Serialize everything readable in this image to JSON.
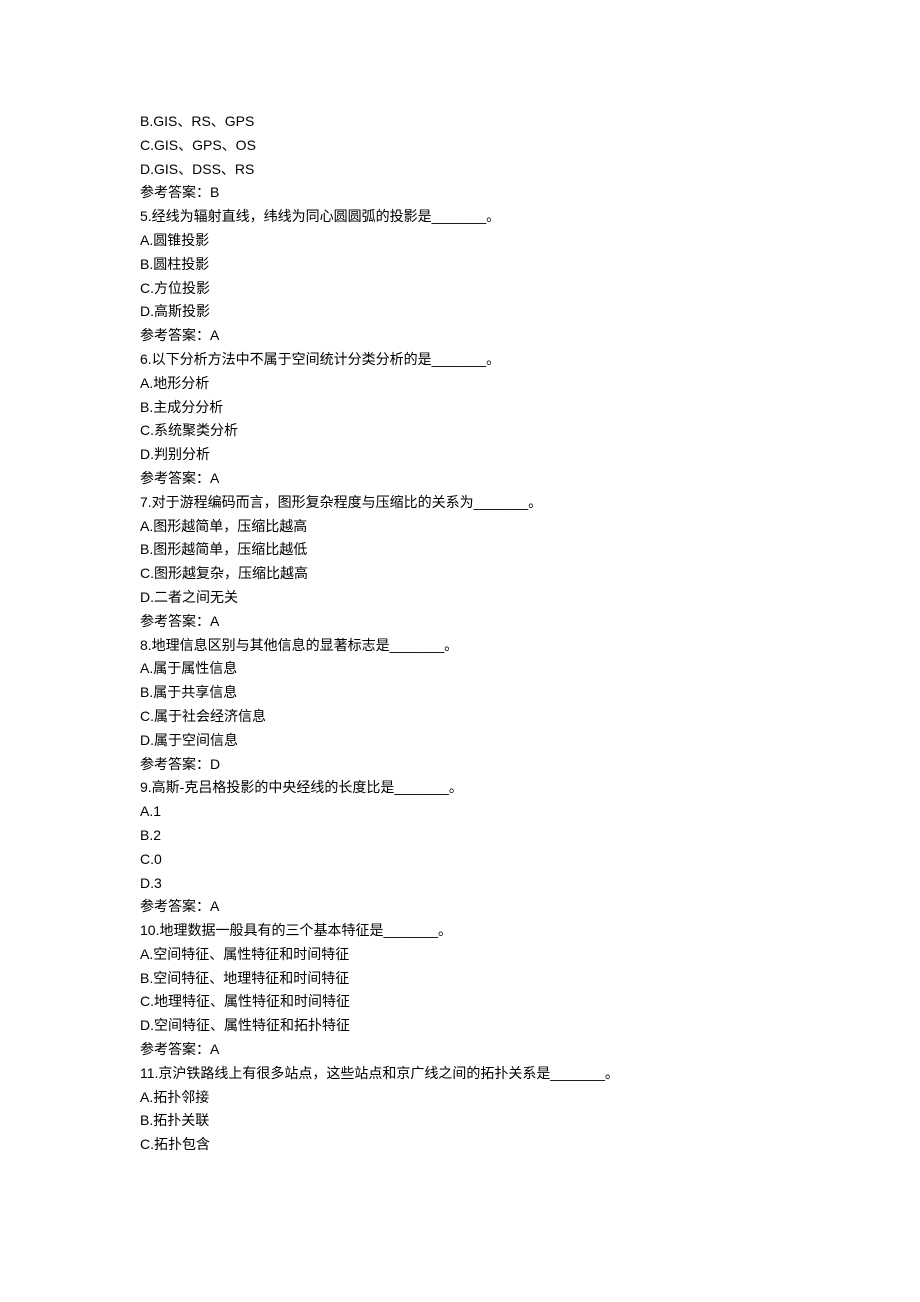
{
  "lines": [
    {
      "type": "opt",
      "text": "B.GIS、RS、GPS"
    },
    {
      "type": "opt",
      "text": "C.GIS、GPS、OS"
    },
    {
      "type": "opt",
      "text": "D.GIS、DSS、RS"
    },
    {
      "type": "ans",
      "text": "参考答案：B"
    },
    {
      "type": "q",
      "text": "5.经线为辐射直线，纬线为同心圆圆弧的投影是_______。"
    },
    {
      "type": "opt",
      "text": "A.圆锥投影"
    },
    {
      "type": "opt",
      "text": "B.圆柱投影"
    },
    {
      "type": "opt",
      "text": "C.方位投影"
    },
    {
      "type": "opt",
      "text": "D.高斯投影"
    },
    {
      "type": "ans",
      "text": "参考答案：A"
    },
    {
      "type": "q",
      "text": "6.以下分析方法中不属于空间统计分类分析的是_______。"
    },
    {
      "type": "opt",
      "text": "A.地形分析"
    },
    {
      "type": "opt",
      "text": "B.主成分分析"
    },
    {
      "type": "opt",
      "text": "C.系统聚类分析"
    },
    {
      "type": "opt",
      "text": "D.判别分析"
    },
    {
      "type": "ans",
      "text": "参考答案：A"
    },
    {
      "type": "q",
      "text": "7.对于游程编码而言，图形复杂程度与压缩比的关系为_______。"
    },
    {
      "type": "opt",
      "text": "A.图形越简单，压缩比越高"
    },
    {
      "type": "opt",
      "text": "B.图形越简单，压缩比越低"
    },
    {
      "type": "opt",
      "text": "C.图形越复杂，压缩比越高"
    },
    {
      "type": "opt",
      "text": "D.二者之间无关"
    },
    {
      "type": "ans",
      "text": "参考答案：A"
    },
    {
      "type": "q",
      "text": "8.地理信息区别与其他信息的显著标志是_______。"
    },
    {
      "type": "opt",
      "text": "A.属于属性信息"
    },
    {
      "type": "opt",
      "text": "B.属于共享信息"
    },
    {
      "type": "opt",
      "text": "C.属于社会经济信息"
    },
    {
      "type": "opt",
      "text": "D.属于空间信息"
    },
    {
      "type": "ans",
      "text": "参考答案：D"
    },
    {
      "type": "q",
      "text": "9.高斯-克吕格投影的中央经线的长度比是_______。"
    },
    {
      "type": "opt",
      "text": "A.1"
    },
    {
      "type": "opt",
      "text": "B.2"
    },
    {
      "type": "opt",
      "text": "C.0"
    },
    {
      "type": "opt",
      "text": "D.3"
    },
    {
      "type": "ans",
      "text": "参考答案：A"
    },
    {
      "type": "q",
      "text": "10.地理数据一般具有的三个基本特征是_______。"
    },
    {
      "type": "opt",
      "text": "A.空间特征、属性特征和时间特征"
    },
    {
      "type": "opt",
      "text": "B.空间特征、地理特征和时间特征"
    },
    {
      "type": "opt",
      "text": "C.地理特征、属性特征和时间特征"
    },
    {
      "type": "opt",
      "text": "D.空间特征、属性特征和拓扑特征"
    },
    {
      "type": "ans",
      "text": "参考答案：A"
    },
    {
      "type": "q",
      "text": "11.京沪铁路线上有很多站点，这些站点和京广线之间的拓扑关系是_______。"
    },
    {
      "type": "opt",
      "text": "A.拓扑邻接"
    },
    {
      "type": "opt",
      "text": "B.拓扑关联"
    },
    {
      "type": "opt",
      "text": "C.拓扑包含"
    }
  ]
}
